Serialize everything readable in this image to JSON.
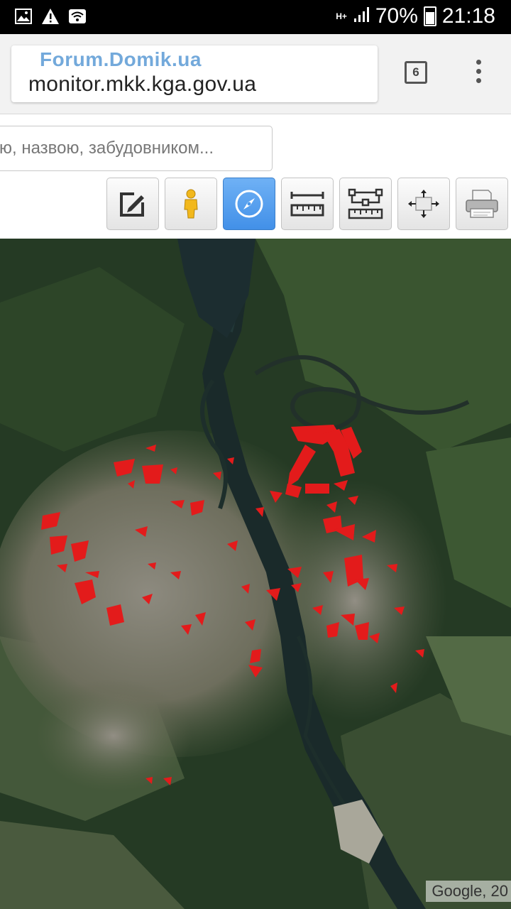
{
  "status_bar": {
    "network": "H+",
    "battery": "70%",
    "time": "21:18",
    "left_icons": [
      "image-icon",
      "warning-icon",
      "wifi-icon"
    ]
  },
  "browser": {
    "url": "monitor.mkk.kga.gov.ua",
    "watermark": "Forum.Domik.ua",
    "tab_count": "6"
  },
  "search": {
    "placeholder": "ю, назвою, забудовником..."
  },
  "toolbar": {
    "tools": [
      "edit-icon",
      "pegman-icon",
      "compass-icon",
      "ruler-icon",
      "area-measure-icon",
      "fullscreen-icon",
      "printer-icon"
    ],
    "active_tool": "compass-icon"
  },
  "map": {
    "attribution": "Google, 20",
    "type": "satellite"
  },
  "colors": {
    "highlight": "#e31b1b",
    "active_tool": "#4a98ec"
  }
}
